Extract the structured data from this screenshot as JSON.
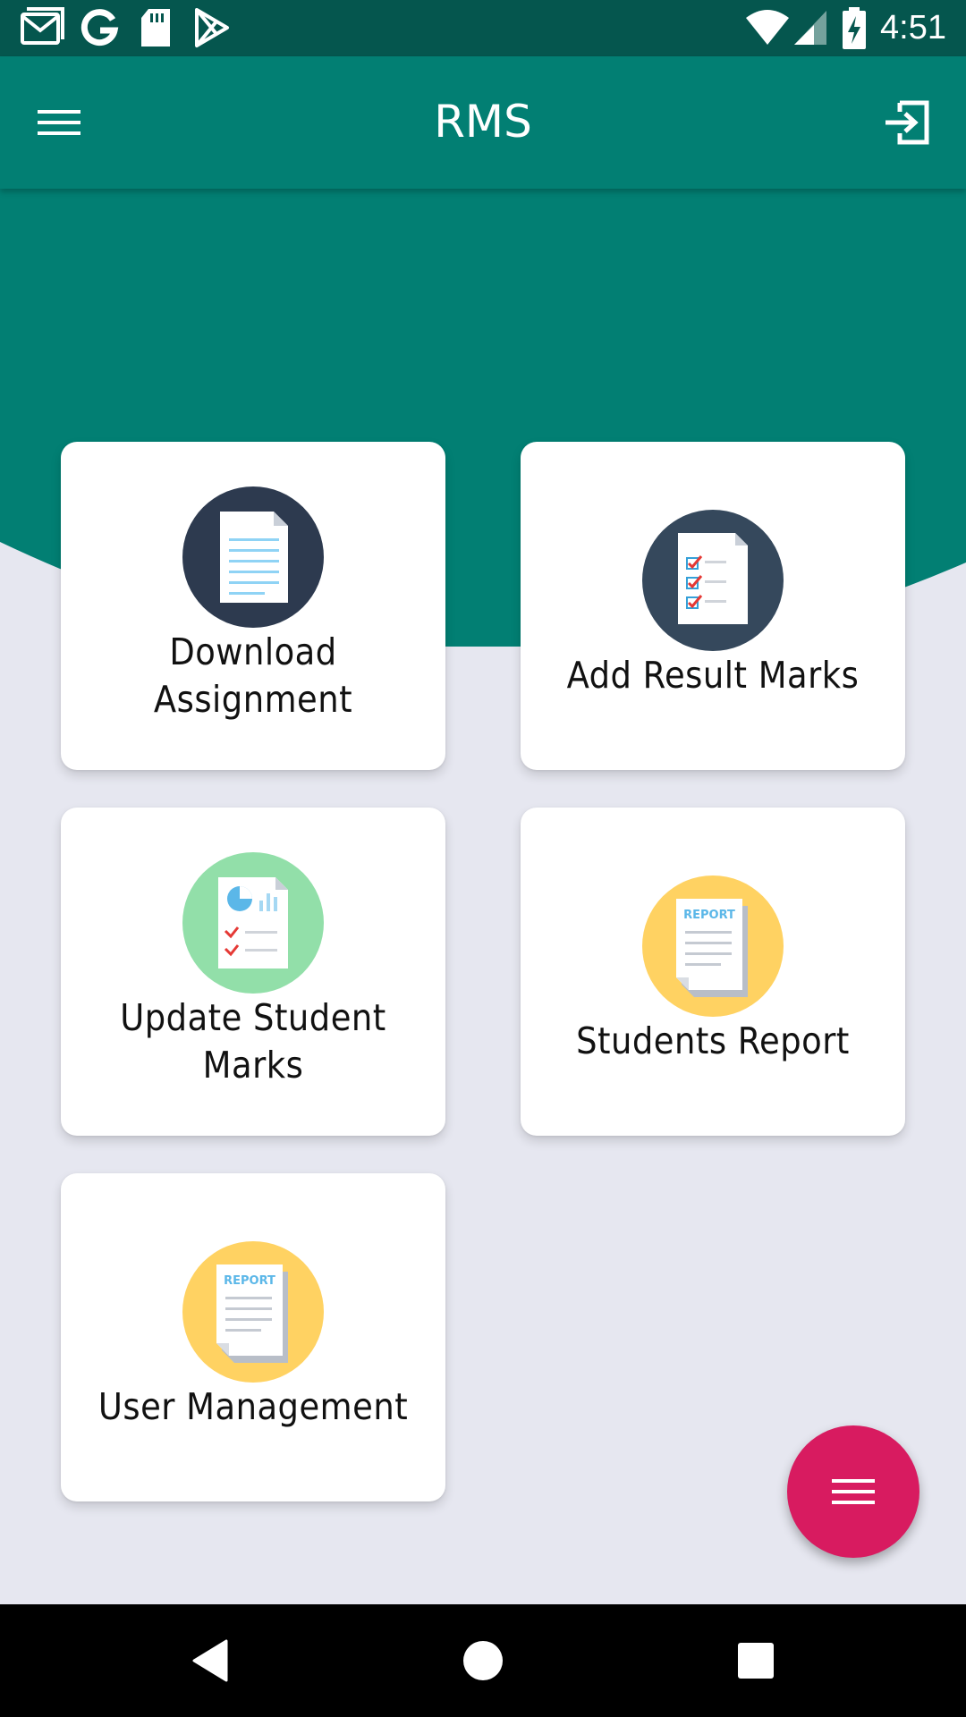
{
  "status_bar": {
    "time": "4:51",
    "left_icons": [
      "gmail-icon",
      "google-icon",
      "sd-card-icon",
      "play-store-icon"
    ],
    "right_icons": [
      "wifi-icon",
      "cell-signal-icon",
      "battery-charging-icon"
    ]
  },
  "app_bar": {
    "title": "RMS",
    "menu_icon": "hamburger-menu-icon",
    "logout_icon": "logout-icon",
    "color": "#027F73"
  },
  "cards": [
    {
      "id": "download-assignment",
      "label_lines": [
        "Download",
        "Assignment"
      ],
      "icon": "document-icon",
      "icon_bg": "#2D3A4F"
    },
    {
      "id": "add-result-marks",
      "label_lines": [
        "Add Result Marks"
      ],
      "icon": "checklist-icon",
      "icon_bg": "#35485C"
    },
    {
      "id": "update-student-marks",
      "label_lines": [
        "Update Student",
        "Marks"
      ],
      "icon": "chart-report-icon",
      "icon_bg": "#92DFA9"
    },
    {
      "id": "students-report",
      "label_lines": [
        "Students Report"
      ],
      "icon": "report-icon",
      "icon_bg": "#FFD262",
      "icon_text": "REPORT"
    },
    {
      "id": "user-management",
      "label_lines": [
        "User Management"
      ],
      "icon": "report-icon",
      "icon_bg": "#FFD262",
      "icon_text": "REPORT"
    }
  ],
  "fab": {
    "icon": "menu-lines-icon",
    "color": "#D81B60"
  },
  "nav_bar": {
    "icons": [
      "back-icon",
      "home-icon",
      "recents-icon"
    ]
  },
  "colors": {
    "background": "#E6E7F0",
    "teal": "#027F73",
    "status_bar": "#05564E"
  }
}
